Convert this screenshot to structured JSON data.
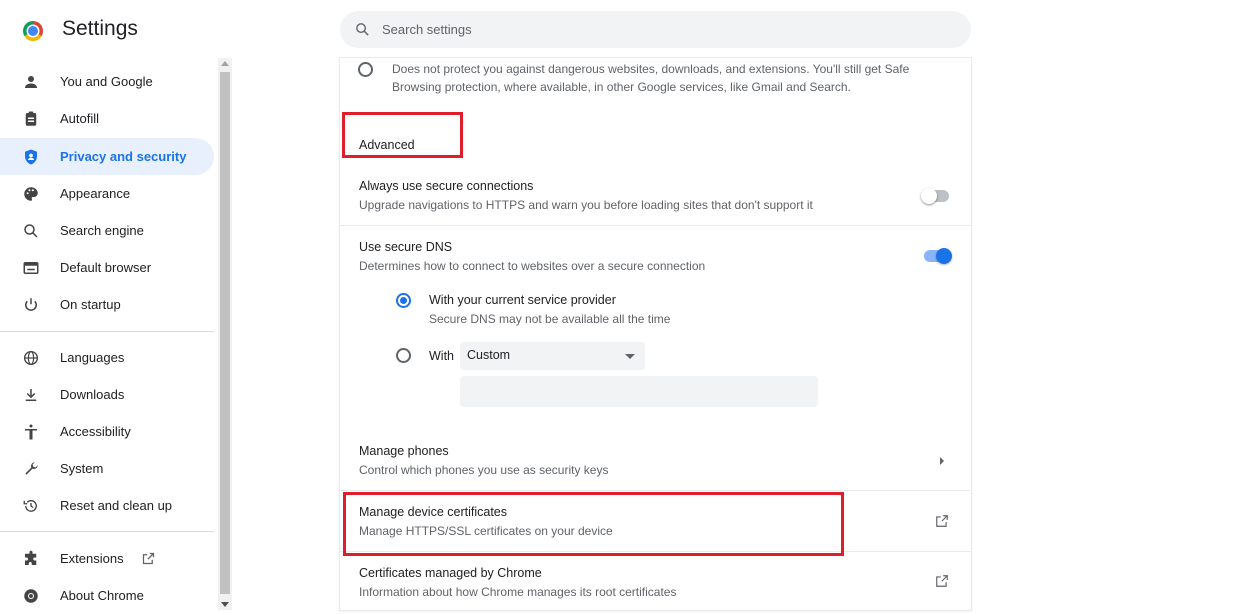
{
  "header": {
    "title": "Settings",
    "search_placeholder": "Search settings"
  },
  "sidebar": {
    "items": [
      {
        "label": "You and Google",
        "icon": "person-icon"
      },
      {
        "label": "Autofill",
        "icon": "clipboard-icon"
      },
      {
        "label": "Privacy and security",
        "icon": "shield-icon",
        "active": true
      },
      {
        "label": "Appearance",
        "icon": "palette-icon"
      },
      {
        "label": "Search engine",
        "icon": "search-icon"
      },
      {
        "label": "Default browser",
        "icon": "browser-icon"
      },
      {
        "label": "On startup",
        "icon": "power-icon"
      },
      {
        "label": "Languages",
        "icon": "globe-icon"
      },
      {
        "label": "Downloads",
        "icon": "download-icon"
      },
      {
        "label": "Accessibility",
        "icon": "accessibility-icon"
      },
      {
        "label": "System",
        "icon": "wrench-icon"
      },
      {
        "label": "Reset and clean up",
        "icon": "restore-icon"
      },
      {
        "label": "Extensions",
        "icon": "puzzle-icon"
      },
      {
        "label": "About Chrome",
        "icon": "chrome-icon"
      }
    ]
  },
  "main": {
    "no_protection": {
      "line1": "Does not protect you against dangerous websites, downloads, and extensions. You'll still get Safe",
      "line2": "Browsing protection, where available, in other Google services, like Gmail and Search."
    },
    "advanced_heading": "Advanced",
    "secure_connections": {
      "title": "Always use secure connections",
      "subtitle": "Upgrade navigations to HTTPS and warn you before loading sites that don't support it",
      "enabled": false
    },
    "secure_dns": {
      "title": "Use secure DNS",
      "subtitle": "Determines how to connect to websites over a secure connection",
      "enabled": true,
      "option_current_title": "With your current service provider",
      "option_current_subtitle": "Secure DNS may not be available all the time",
      "option_with_label": "With",
      "custom_value": "Custom"
    },
    "manage_phones": {
      "title": "Manage phones",
      "subtitle": "Control which phones you use as security keys"
    },
    "manage_certificates": {
      "title": "Manage device certificates",
      "subtitle": "Manage HTTPS/SSL certificates on your device"
    },
    "chrome_certificates": {
      "title": "Certificates managed by Chrome",
      "subtitle": "Information about how Chrome manages its root certificates"
    }
  },
  "colors": {
    "accent": "#1a73e8",
    "highlight_box": "#e01e2b",
    "active_bg": "#e8f0fe"
  }
}
